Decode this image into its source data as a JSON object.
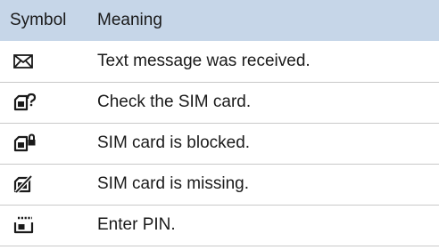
{
  "table": {
    "header": {
      "symbol": "Symbol",
      "meaning": "Meaning"
    },
    "rows": [
      {
        "icon": "envelope-icon",
        "meaning": "Text message was received."
      },
      {
        "icon": "sim-check-icon",
        "meaning": "Check the SIM card."
      },
      {
        "icon": "sim-blocked-icon",
        "meaning": "SIM card is blocked."
      },
      {
        "icon": "sim-missing-icon",
        "meaning": "SIM card is missing."
      },
      {
        "icon": "sim-pin-icon",
        "meaning": "Enter PIN."
      }
    ]
  },
  "colors": {
    "header_background": "#c6d6e8",
    "row_divider": "#c9c9c9",
    "text": "#1a1a1a"
  }
}
